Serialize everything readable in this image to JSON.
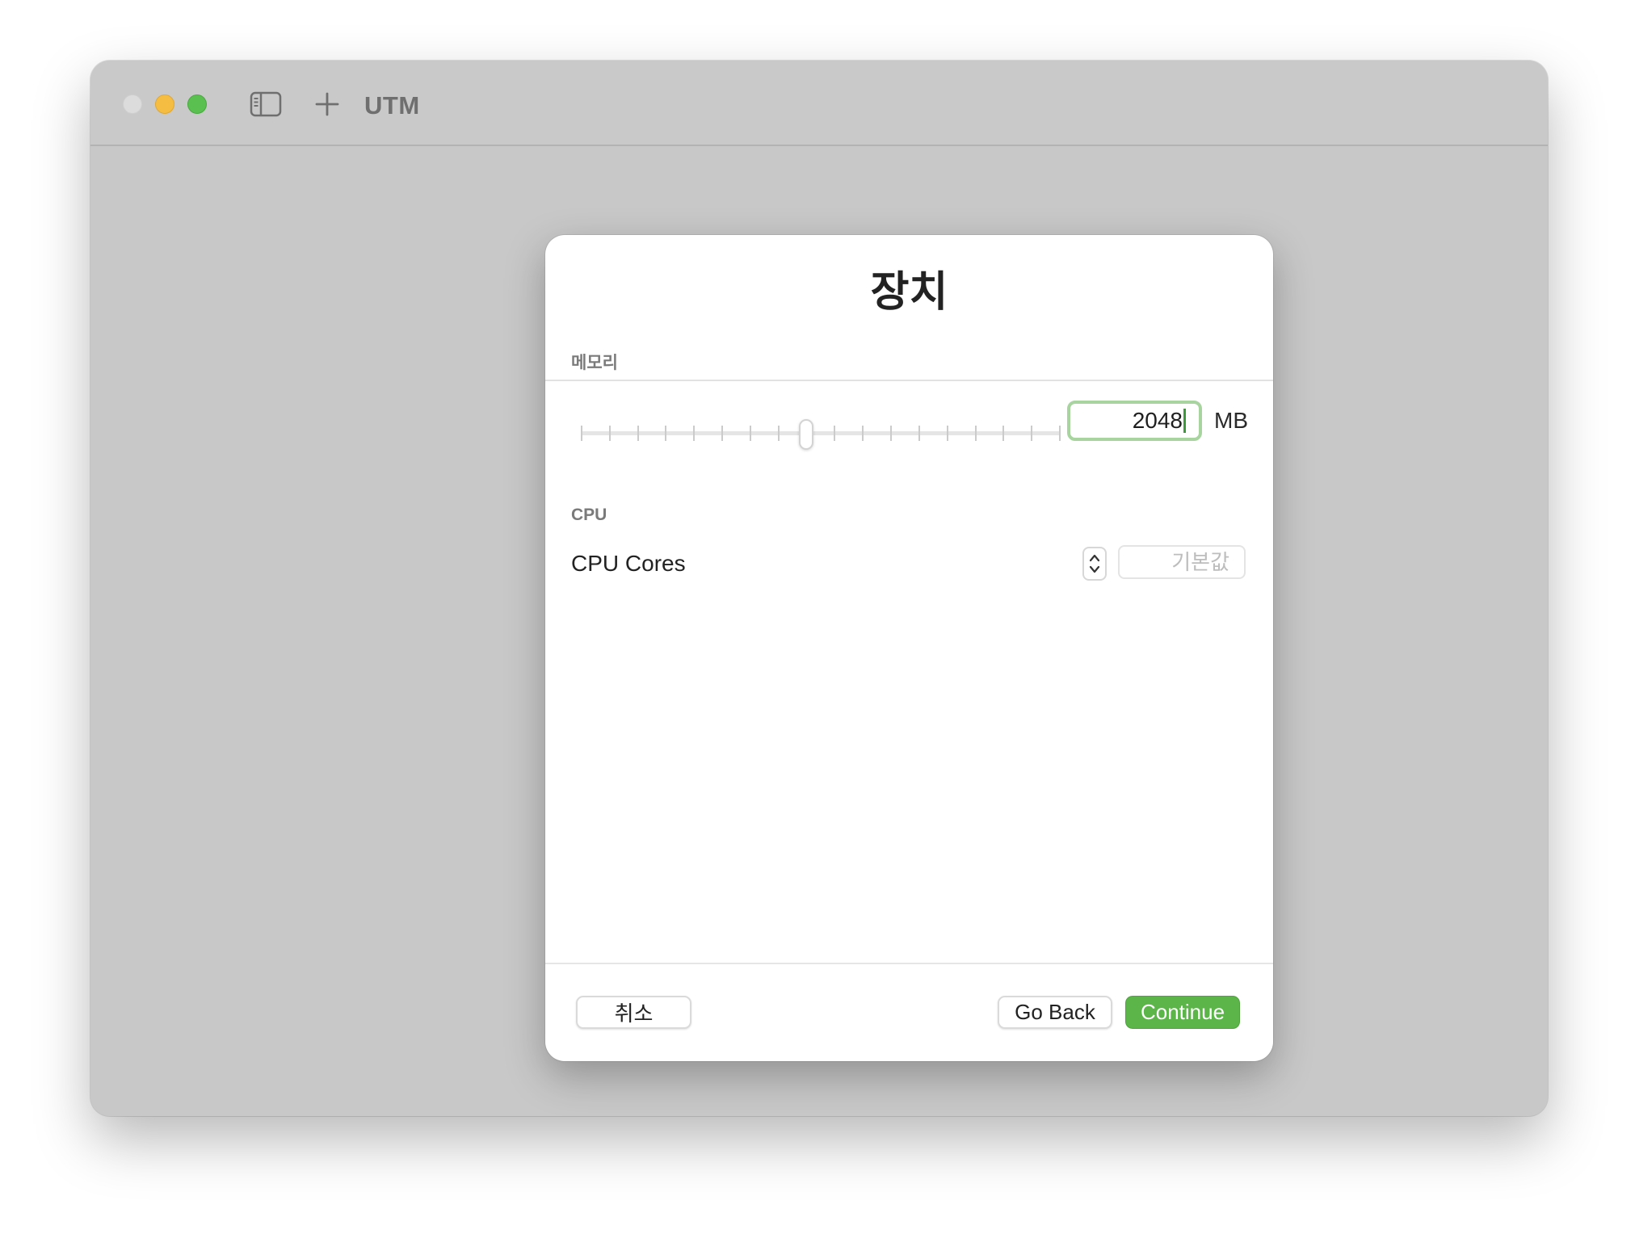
{
  "window": {
    "app_title": "UTM",
    "icons": [
      "close-button",
      "minimize-button",
      "zoom-button",
      "sidebar-toggle-icon",
      "plus-icon"
    ]
  },
  "dialog": {
    "title": "장치",
    "memory": {
      "section_label": "메모리",
      "value": "2048",
      "unit": "MB",
      "slider_position_fraction": 0.47,
      "slider_tick_count": 18
    },
    "cpu": {
      "section_label": "CPU",
      "cores_label": "CPU Cores",
      "cores_placeholder": "기본값"
    },
    "buttons": {
      "cancel": "취소",
      "go_back": "Go Back",
      "continue": "Continue"
    }
  },
  "colors": {
    "accent": "#5bb548",
    "focus_ring": "#a8d4a0",
    "window_bg": "#c8c8c8"
  }
}
